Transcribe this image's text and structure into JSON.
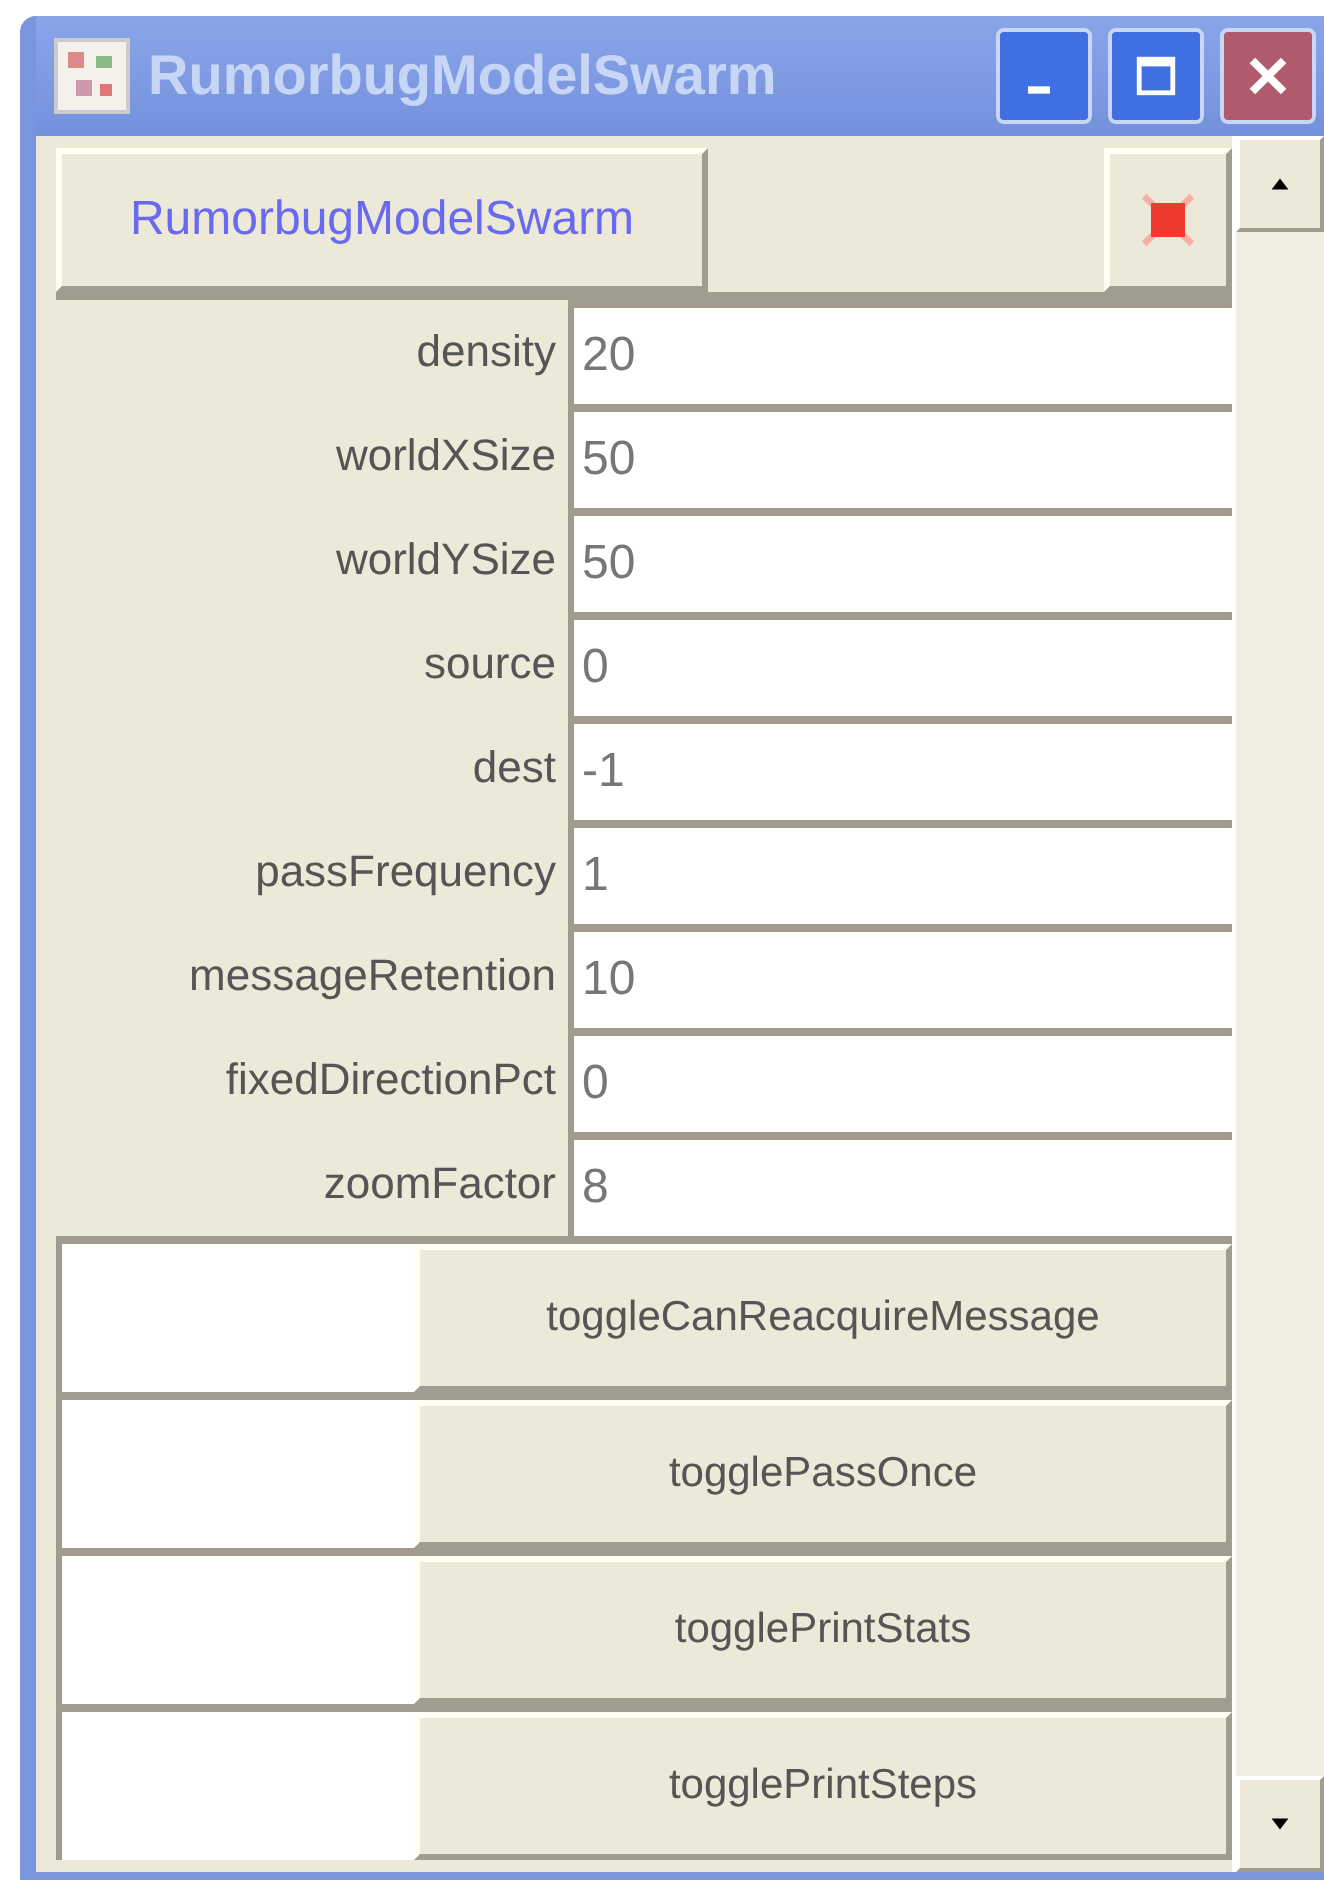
{
  "window": {
    "title": "RumorbugModelSwarm"
  },
  "header": {
    "button": "RumorbugModelSwarm"
  },
  "fields": [
    {
      "label": "density",
      "value": "20"
    },
    {
      "label": "worldXSize",
      "value": "50"
    },
    {
      "label": "worldYSize",
      "value": "50"
    },
    {
      "label": "source",
      "value": "0"
    },
    {
      "label": "dest",
      "value": "-1"
    },
    {
      "label": "passFrequency",
      "value": "1"
    },
    {
      "label": "messageRetention",
      "value": "10"
    },
    {
      "label": "fixedDirectionPct",
      "value": "0"
    },
    {
      "label": "zoomFactor",
      "value": "8"
    }
  ],
  "toggles": [
    {
      "label": "toggleCanReacquireMessage"
    },
    {
      "label": "togglePassOnce"
    },
    {
      "label": "togglePrintStats"
    },
    {
      "label": "togglePrintSteps"
    }
  ]
}
